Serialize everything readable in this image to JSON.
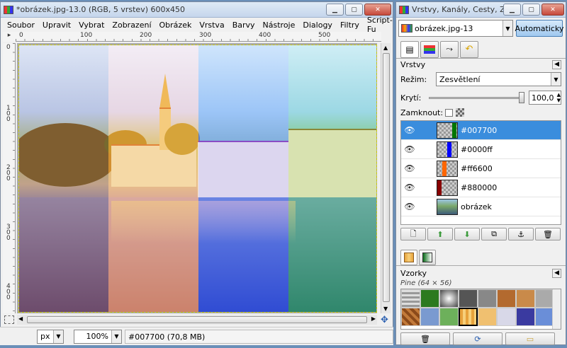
{
  "image_window": {
    "title": "*obrázek.jpg-13.0 (RGB, 5 vrstev) 600x450",
    "menu": [
      "Soubor",
      "Upravit",
      "Vybrat",
      "Zobrazení",
      "Obrázek",
      "Vrstva",
      "Barvy",
      "Nástroje",
      "Dialogy",
      "Filtry",
      "Script-Fu"
    ],
    "ruler_top": [
      "0",
      "100",
      "200",
      "300",
      "400",
      "500"
    ],
    "ruler_left": [
      "0",
      "1 0 0",
      "2 0 0",
      "3 0 0",
      "4 0 0"
    ],
    "status": {
      "unit": "px",
      "zoom": "100%",
      "info": "#007700 (70,8 MB)"
    }
  },
  "dock": {
    "title": "Vrstvy, Kanály, Cesty, Zpět...",
    "image_selector": "obrázek.jpg-13",
    "auto_button": "Automaticky",
    "layers_panel": {
      "title": "Vrstvy",
      "mode_label": "Režim:",
      "mode_value": "Zesvětlení",
      "opacity_label": "Krytí:",
      "opacity_value": "100,0",
      "lock_label": "Zamknout:"
    },
    "layers": [
      {
        "name": "#007700",
        "color": "#007700",
        "selected": true
      },
      {
        "name": "#0000ff",
        "color": "#0000ff",
        "selected": false
      },
      {
        "name": "#ff6600",
        "color": "#ff6600",
        "selected": false
      },
      {
        "name": "#880000",
        "color": "#880000",
        "selected": false
      },
      {
        "name": "obrázek",
        "color": "",
        "selected": false
      }
    ],
    "patterns_panel": {
      "title": "Vzorky",
      "selected": "Pine (64 × 56)"
    }
  }
}
